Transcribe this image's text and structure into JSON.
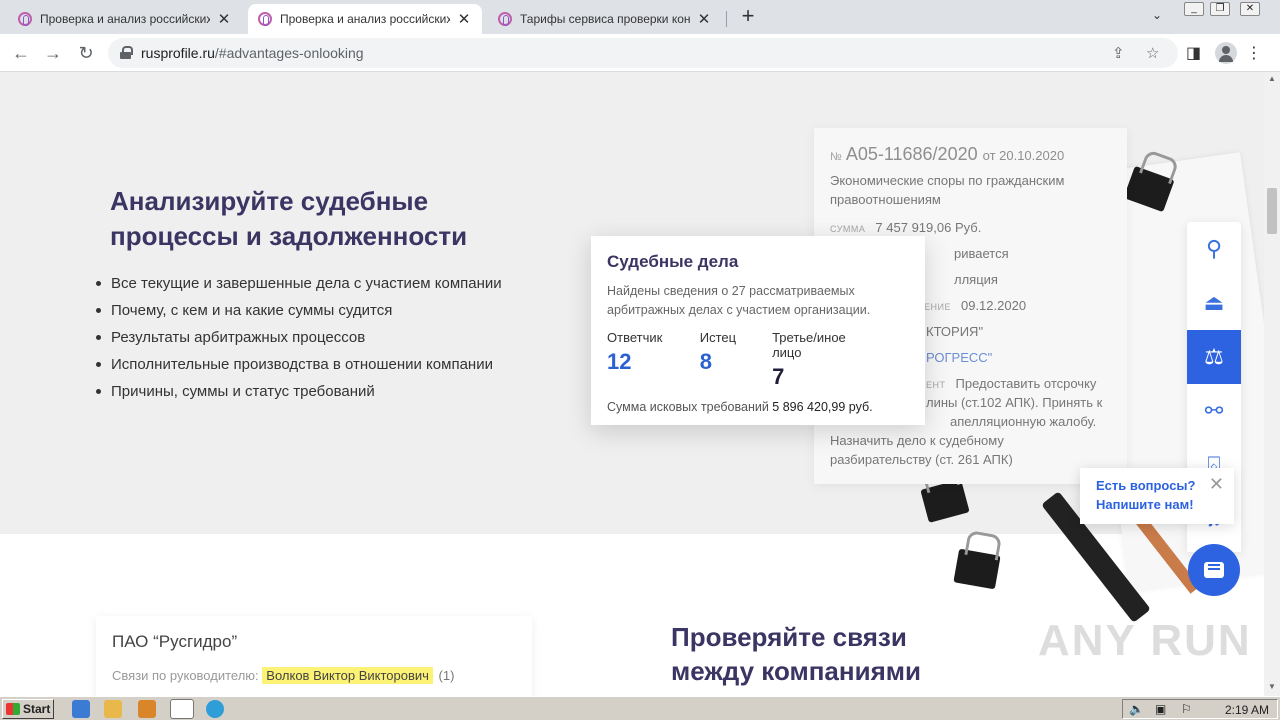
{
  "browser": {
    "tabs": [
      {
        "title": "Проверка и анализ российских юр",
        "active": false
      },
      {
        "title": "Проверка и анализ российских юр",
        "active": true
      },
      {
        "title": "Тарифы сервиса проверки контра",
        "active": false
      }
    ],
    "url_host": "rusprofile.ru",
    "url_path": "/#advantages-onlooking"
  },
  "courts_section": {
    "heading": "Анализируйте судебные процессы и задолженности",
    "bullets": [
      "Все текущие и завершенные дела с участием компании",
      "Почему, с кем и на какие суммы судится",
      "Результаты арбитражных процессов",
      "Исполнительные производства в отношении компании",
      "Причины, суммы и статус требований"
    ]
  },
  "case_card": {
    "no_label": "№",
    "number": "А05-11686/2020",
    "date": "от 20.10.2020",
    "category": "Экономические споры по гражданским правоотношениям",
    "sum_label": "СУММА",
    "sum_value": "7 457 919,06 Руб.",
    "line_status": "ривается",
    "line_instance": "лляция",
    "date_label": "ЕНИЕ",
    "date_value": "09.12.2020",
    "party1": "КТОРИЯ\"",
    "party2": "РОГРЕСС\"",
    "doc_label": "ЕНТ",
    "doc_line1": "Предоставить отсрочку",
    "doc_line2": "лины (ст.102 АПК). Принять к",
    "doc_line3": "апелляционную жалобу.",
    "doc_line4": "Назначить дело к судебному",
    "doc_line5": "разбирательству (ст. 261 АПК)"
  },
  "court_popup": {
    "title": "Судебные дела",
    "description": "Найдены сведения о 27 рассматриваемых арбитражных делах с участием организации.",
    "stats": [
      {
        "label": "Ответчик",
        "value": "12"
      },
      {
        "label": "Истец",
        "value": "8"
      },
      {
        "label": "Третье/иное лицо",
        "value": "7"
      }
    ],
    "sum_label": "Сумма исковых требований",
    "sum_value": "5 896 420,99 руб."
  },
  "sidenav": {
    "items": [
      "search-icon",
      "pedestal-icon",
      "scales-icon",
      "links-icon",
      "briefcase-icon",
      "bell-icon"
    ],
    "active_index": 2
  },
  "chat": {
    "line1": "Есть вопросы?",
    "line2": "Напишите нам!"
  },
  "links_section": {
    "card_title": "ПАО “Русгидро”",
    "row_label": "Связи по руководителю:",
    "person": "Волков Виктор Викторович",
    "count": "(1)",
    "heading": "Проверяйте связи между компаниями"
  },
  "watermark": "ANY RUN",
  "taskbar": {
    "start_label": "Start",
    "clock": "2:19 AM"
  },
  "colors": {
    "accent": "#2d63e0",
    "heading": "#3b3563",
    "highlight": "#fcf275"
  }
}
